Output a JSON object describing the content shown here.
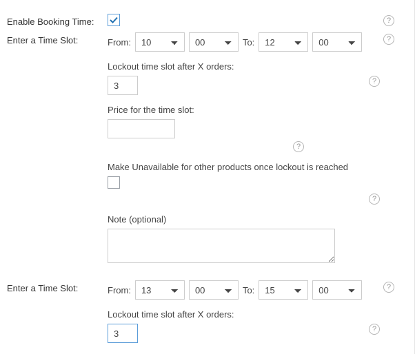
{
  "labels": {
    "enable_booking_time": "Enable Booking Time:",
    "enter_time_slot": "Enter a Time Slot:",
    "from": "From:",
    "to": "To:",
    "lockout_after": "Lockout time slot after X orders:",
    "price_for_slot": "Price for the time slot:",
    "make_unavailable": "Make Unavailable for other products once lockout is reached",
    "note_optional": "Note (optional)"
  },
  "enable_booking_time": {
    "checked": true
  },
  "slot1": {
    "from_hour": "10",
    "from_min": "00",
    "to_hour": "12",
    "to_min": "00",
    "lockout_value": "3",
    "price_value": "",
    "make_unavailable_checked": false,
    "note_value": ""
  },
  "slot2": {
    "from_hour": "13",
    "from_min": "00",
    "to_hour": "15",
    "to_min": "00",
    "lockout_value": "3"
  }
}
